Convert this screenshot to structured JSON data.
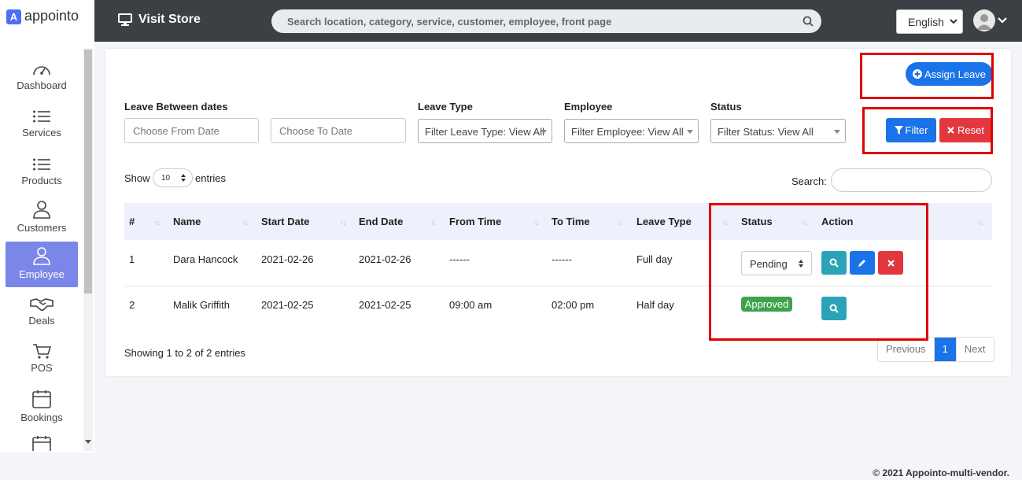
{
  "brand": {
    "name": "appointo",
    "logo_letter": "A"
  },
  "header": {
    "visit_store": "Visit Store",
    "search_placeholder": "Search location, category, service, customer, employee, front page",
    "language": "English"
  },
  "sidebar": {
    "items": [
      {
        "label": "Dashboard",
        "icon": "gauge-icon"
      },
      {
        "label": "Services",
        "icon": "list-icon"
      },
      {
        "label": "Products",
        "icon": "list-icon"
      },
      {
        "label": "Customers",
        "icon": "user-icon"
      },
      {
        "label": "Employee",
        "icon": "user-icon",
        "active": true
      },
      {
        "label": "Deals",
        "icon": "handshake-icon"
      },
      {
        "label": "POS",
        "icon": "cart-icon"
      },
      {
        "label": "Bookings",
        "icon": "calendar-icon"
      }
    ]
  },
  "actions": {
    "assign_leave": "Assign Leave",
    "filter": "Filter",
    "reset": "Reset"
  },
  "filters": {
    "leave_between_label": "Leave Between dates",
    "from_placeholder": "Choose From Date",
    "to_placeholder": "Choose To Date",
    "leave_type_label": "Leave Type",
    "leave_type_value": "Filter Leave Type: View All",
    "employee_label": "Employee",
    "employee_value": "Filter Employee: View All",
    "status_label": "Status",
    "status_value": "Filter Status: View All"
  },
  "table_controls": {
    "show": "Show",
    "entries_value": "10",
    "entries": "entries",
    "search": "Search:"
  },
  "table": {
    "columns": [
      "#",
      "Name",
      "Start Date",
      "End Date",
      "From Time",
      "To Time",
      "Leave Type",
      "Status",
      "Action"
    ],
    "rows": [
      {
        "num": "1",
        "name": "Dara Hancock",
        "start": "2021-02-26",
        "end": "2021-02-26",
        "from": "------",
        "to": "------",
        "type": "Full day",
        "status": "Pending"
      },
      {
        "num": "2",
        "name": "Malik Griffith",
        "start": "2021-02-25",
        "end": "2021-02-25",
        "from": "09:00 am",
        "to": "02:00 pm",
        "type": "Half day",
        "status": "Approved"
      }
    ]
  },
  "table_info": "Showing 1 to 2 of 2 entries",
  "pagination": {
    "previous": "Previous",
    "current": "1",
    "next": "Next"
  },
  "footer": "© 2021 Appointo-multi-vendor.",
  "colors": {
    "primary": "#1a73e8",
    "danger": "#e2373f",
    "info": "#2aa3b8",
    "success": "#3fa24c",
    "sidebar_active": "#7a86e8",
    "highlight": "#e00000",
    "topbar": "#3c4044"
  }
}
